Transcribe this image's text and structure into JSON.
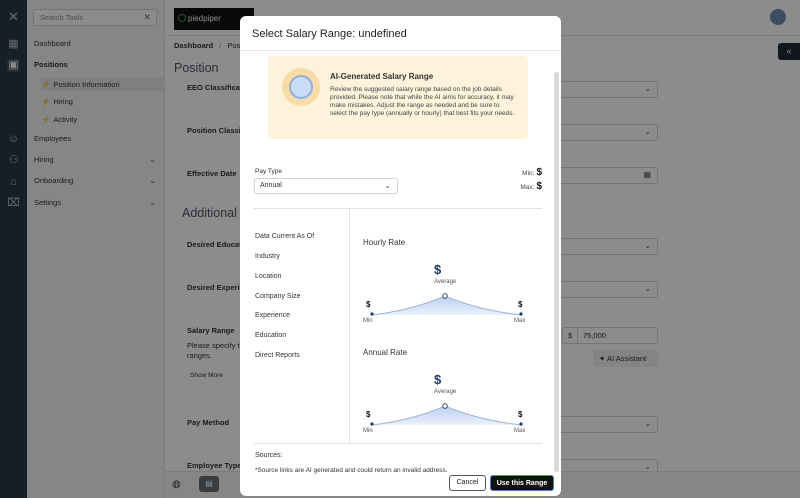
{
  "sidebar": {
    "search_placeholder": "Search Tools",
    "items": [
      {
        "label": "Dashboard"
      },
      {
        "label": "Positions"
      },
      {
        "label": "Employees"
      },
      {
        "label": "Hiring"
      },
      {
        "label": "Onboarding"
      },
      {
        "label": "Settings"
      }
    ],
    "subitems": [
      {
        "label": "Position Information"
      },
      {
        "label": "Hiring"
      },
      {
        "label": "Activity"
      }
    ]
  },
  "topbar": {
    "logo_text": "piedpiper"
  },
  "main": {
    "breadcrumb": {
      "first": "Dashboard",
      "sep": "/",
      "second": "Positi"
    },
    "heading": "Position",
    "section_heading": "Additional",
    "fields": [
      {
        "label": "EEO Classificati"
      },
      {
        "label": "Position Classif"
      },
      {
        "label": "Effective Date"
      },
      {
        "label": "Desired Educat"
      },
      {
        "label": "Desired Experie"
      },
      {
        "label": "Salary Range"
      },
      {
        "label": "Pay Method"
      },
      {
        "label": "Employee Type"
      }
    ],
    "salary_help": "Please specify t",
    "salary_help2": "ranges.",
    "show_more": "Show More",
    "eeo_value_fragment": "rs",
    "salary_currency": "$",
    "salary_value": "75,000",
    "ai_assistant": "AI Assistant"
  },
  "modal": {
    "title": "Select Salary Range: undefined",
    "ai_card": {
      "title": "AI-Generated Salary Range",
      "description": "Review the suggested salary range based on the job details provided. Please note that while the AI aims for accuracy, it may make mistakes. Adjust the range as needed and be sure to select the pay type (annually or hourly) that best fits your needs."
    },
    "pay_type_label": "Pay Type",
    "pay_type_value": "Annual",
    "min_label": "Min:",
    "max_label": "Max:",
    "currency": "$",
    "criteria": [
      "Data Current As Of",
      "Industry",
      "Location",
      "Company Size",
      "Experience",
      "Education",
      "Direct Reports"
    ],
    "hourly_title": "Hourly Rate",
    "annual_title": "Annual Rate",
    "chart_labels": {
      "average": "Average",
      "min": "Min",
      "max": "Max"
    },
    "sources_label": "Sources:",
    "note": "*Source links are AI generated and could return an invalid address.",
    "cancel": "Cancel",
    "use_range": "Use this Range"
  }
}
